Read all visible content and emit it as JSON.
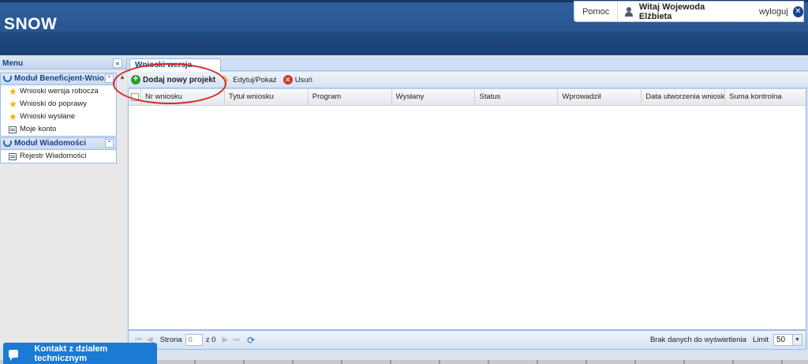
{
  "header": {
    "logo": "SNOW",
    "help_label": "Pomoc",
    "user_greeting": "Witaj Wojewoda Elżbieta",
    "logout_label": "wyloguj"
  },
  "sidebar": {
    "title": "Menu",
    "modules": [
      {
        "title": "Moduł Beneficjent-Wnio...",
        "items": [
          {
            "label": "Wnioski wersja robocza",
            "icon": "star-icon"
          },
          {
            "label": "Wnioski do poprawy",
            "icon": "star-icon"
          },
          {
            "label": "Wnioski wysłane",
            "icon": "star-icon"
          },
          {
            "label": "Moje konto",
            "icon": "document-icon"
          }
        ]
      },
      {
        "title": "Moduł Wiadomości",
        "items": [
          {
            "label": "Rejestr Wiadomości",
            "icon": "document-icon"
          }
        ]
      }
    ]
  },
  "main": {
    "tab_label": "Wnioski wersja robocza",
    "toolbar": {
      "add_label": "Dodaj nowy projekt",
      "edit_label": "Edytuj/Pokaż",
      "delete_label": "Usuń"
    },
    "grid": {
      "columns": [
        "Nr wniosku",
        "Tytuł wniosku",
        "Program",
        "Wysłany",
        "Status",
        "Wprowadził",
        "Data utworzenia wniosku",
        "Suma kontrolna"
      ],
      "rows": []
    },
    "pager": {
      "page_label": "Strona",
      "page_value": "0",
      "of_label": "z 0",
      "empty_message": "Brak danych do wyświetlenia",
      "limit_label": "Limit",
      "limit_value": "50"
    }
  },
  "contact_button_label": "Kontakt z działem technicznym",
  "colors": {
    "header_blue": "#2a5792",
    "panel_text": "#15428b",
    "highlight_red": "#d42a22",
    "contact_blue": "#1b7ad4"
  }
}
